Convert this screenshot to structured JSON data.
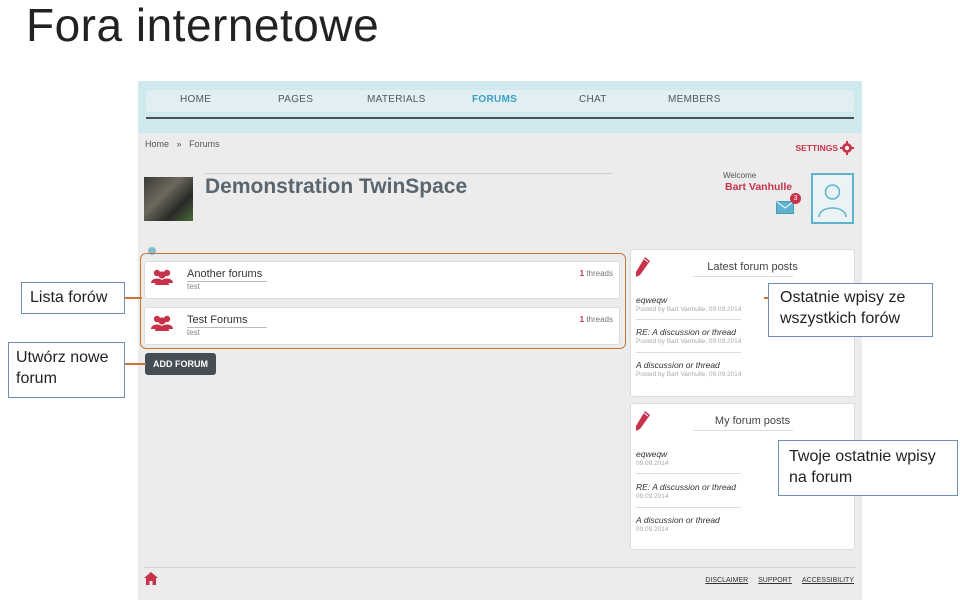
{
  "slide": {
    "title": "Fora internetowe"
  },
  "nav": {
    "items": [
      "HOME",
      "PAGES",
      "MATERIALS",
      "FORUMS",
      "CHAT",
      "MEMBERS"
    ],
    "active": "FORUMS"
  },
  "breadcrumb": {
    "home": "Home",
    "sep": "»",
    "current": "Forums"
  },
  "settings": {
    "label": "SETTINGS"
  },
  "space": {
    "title": "Demonstration TwinSpace"
  },
  "user": {
    "welcome": "Welcome",
    "name": "Bart Vanhulle",
    "mail_count": "3"
  },
  "forums": [
    {
      "name": "Another forums",
      "desc": "test",
      "count": "1",
      "unit": "threads"
    },
    {
      "name": "Test Forums",
      "desc": "test",
      "count": "1",
      "unit": "threads"
    }
  ],
  "add_forum": {
    "label": "ADD FORUM"
  },
  "latest_posts": {
    "title": "Latest forum posts",
    "items": [
      {
        "title": "eqweqw",
        "meta": "Posted by Bart Vanhulle, 09.09.2014"
      },
      {
        "title": "RE: A discussion or thread",
        "meta": "Posted by Bart Vanhulle, 09.09.2014"
      },
      {
        "title": "A discussion or thread",
        "meta": "Posted by Bart Vanhulle, 09.09.2014"
      }
    ]
  },
  "my_posts": {
    "title": "My forum posts",
    "items": [
      {
        "title": "eqweqw",
        "meta": "09.09.2014"
      },
      {
        "title": "RE: A discussion or thread",
        "meta": "09.09.2014"
      },
      {
        "title": "A discussion or thread",
        "meta": "09.09.2014"
      }
    ]
  },
  "footer": {
    "links": [
      "DISCLAIMER",
      "SUPPORT",
      "ACCESSIBILITY"
    ]
  },
  "callouts": {
    "forum_list": "Lista forów",
    "create_forum": "Utwórz nowe forum",
    "latest_all": "Ostatnie wpisy ze wszystkich forów",
    "my_latest": "Twoje ostatnie wpisy na forum"
  },
  "colors": {
    "accent": "#3aa0c8",
    "brand_red": "#c8324a",
    "callout_border": "#6e8eb8",
    "connector": "#c9753a"
  }
}
